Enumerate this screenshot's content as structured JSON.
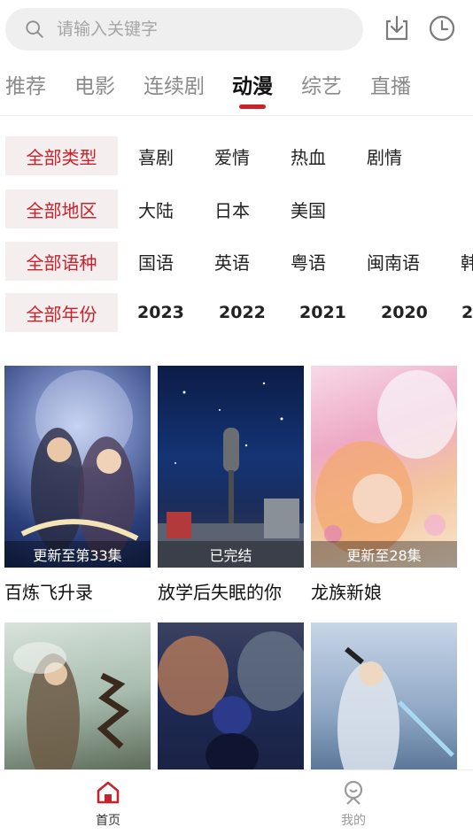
{
  "search": {
    "placeholder": "请输入关键字"
  },
  "tabs": [
    {
      "label": "推荐"
    },
    {
      "label": "电影"
    },
    {
      "label": "连续剧"
    },
    {
      "label": "动漫"
    },
    {
      "label": "综艺"
    },
    {
      "label": "直播"
    }
  ],
  "active_tab": "动漫",
  "accent_color": "#c8222c",
  "filters": {
    "type": {
      "label": "全部类型",
      "options": [
        "喜剧",
        "爱情",
        "热血",
        "剧情"
      ]
    },
    "region": {
      "label": "全部地区",
      "options": [
        "大陆",
        "日本",
        "美国"
      ]
    },
    "language": {
      "label": "全部语种",
      "options": [
        "国语",
        "英语",
        "粤语",
        "闽南语",
        "韩"
      ]
    },
    "year": {
      "label": "全部年份",
      "options": [
        "2023",
        "2022",
        "2021",
        "2020",
        "2"
      ]
    }
  },
  "cards": [
    {
      "title": "百炼飞升录",
      "badge": "更新至第33集"
    },
    {
      "title": "放学后失眠的你",
      "badge": "已完结"
    },
    {
      "title": "龙族新娘",
      "badge": "更新至28集"
    },
    {
      "title": "",
      "badge": ""
    },
    {
      "title": "",
      "badge": ""
    },
    {
      "title": "",
      "badge": ""
    }
  ],
  "bottom_nav": {
    "home": {
      "label": "首页",
      "icon": "home-icon"
    },
    "mine": {
      "label": "我的",
      "icon": "user-icon"
    }
  }
}
